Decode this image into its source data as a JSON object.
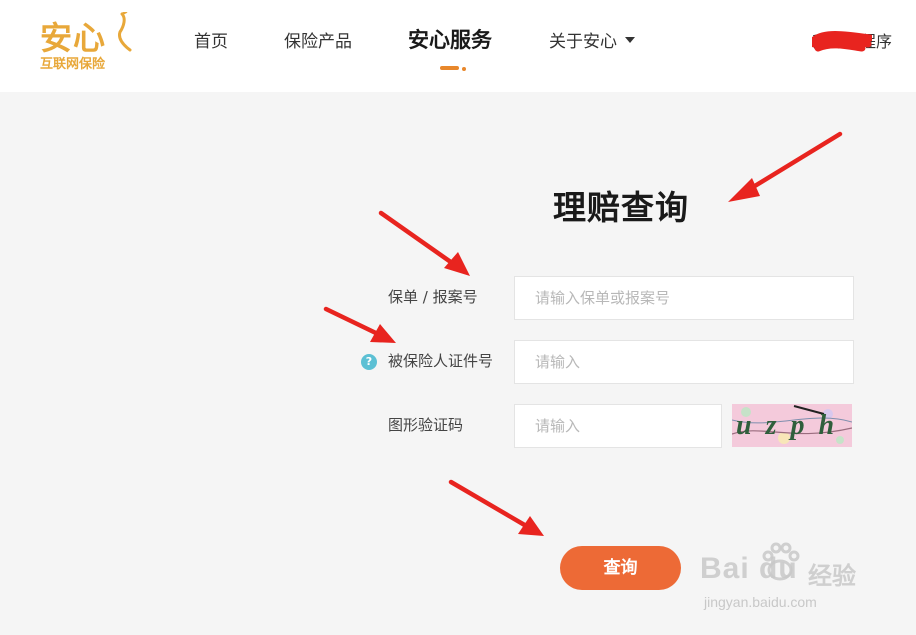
{
  "header": {
    "logo_main": "安心",
    "logo_sub": "互联网保险",
    "nav": [
      {
        "label": "首页"
      },
      {
        "label": "保险产品"
      },
      {
        "label": "安心服务"
      },
      {
        "label": "关于安心"
      }
    ],
    "user_text": "我的小程序"
  },
  "main": {
    "title": "理赔查询",
    "fields": [
      {
        "label": "保单 / 报案号",
        "placeholder": "请输入保单或报案号",
        "value": ""
      },
      {
        "label": "被保险人证件号",
        "placeholder": "请输入",
        "value": ""
      },
      {
        "label": "图形验证码",
        "placeholder": "请输入",
        "value": ""
      }
    ],
    "captcha_text": "uzph",
    "submit_label": "查询"
  },
  "watermark": {
    "brand": "Bai du",
    "product": "经验",
    "url": "jingyan.baidu.com"
  },
  "colors": {
    "brand": "#e8a83a",
    "accent": "#ed6a36",
    "annotation": "#e8241f",
    "help": "#5cc0d4"
  }
}
